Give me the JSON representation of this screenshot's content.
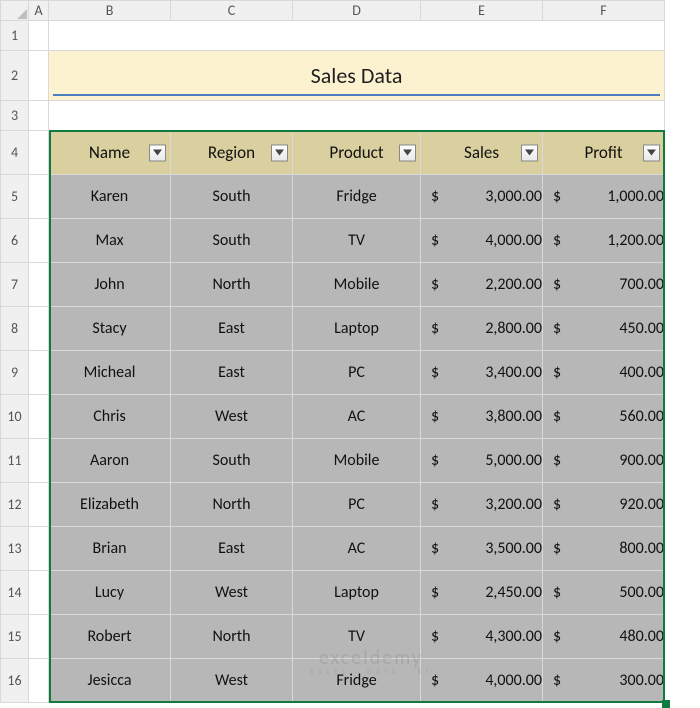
{
  "columns": [
    "A",
    "B",
    "C",
    "D",
    "E",
    "F"
  ],
  "row_numbers": [
    1,
    2,
    3,
    4,
    5,
    6,
    7,
    8,
    9,
    10,
    11,
    12,
    13,
    14,
    15,
    16
  ],
  "title": "Sales Data",
  "headers": {
    "name": "Name",
    "region": "Region",
    "product": "Product",
    "sales": "Sales",
    "profit": "Profit"
  },
  "rows": [
    {
      "name": "Karen",
      "region": "South",
      "product": "Fridge",
      "sales": "3,000.00",
      "profit": "1,000.00"
    },
    {
      "name": "Max",
      "region": "South",
      "product": "TV",
      "sales": "4,000.00",
      "profit": "1,200.00"
    },
    {
      "name": "John",
      "region": "North",
      "product": "Mobile",
      "sales": "2,200.00",
      "profit": "700.00"
    },
    {
      "name": "Stacy",
      "region": "East",
      "product": "Laptop",
      "sales": "2,800.00",
      "profit": "450.00"
    },
    {
      "name": "Micheal",
      "region": "East",
      "product": "PC",
      "sales": "3,400.00",
      "profit": "400.00"
    },
    {
      "name": "Chris",
      "region": "West",
      "product": "AC",
      "sales": "3,800.00",
      "profit": "560.00"
    },
    {
      "name": "Aaron",
      "region": "South",
      "product": "Mobile",
      "sales": "5,000.00",
      "profit": "900.00"
    },
    {
      "name": "Elizabeth",
      "region": "North",
      "product": "PC",
      "sales": "3,200.00",
      "profit": "920.00"
    },
    {
      "name": "Brian",
      "region": "East",
      "product": "AC",
      "sales": "3,500.00",
      "profit": "800.00"
    },
    {
      "name": "Lucy",
      "region": "West",
      "product": "Laptop",
      "sales": "2,450.00",
      "profit": "500.00"
    },
    {
      "name": "Robert",
      "region": "North",
      "product": "TV",
      "sales": "4,300.00",
      "profit": "480.00"
    },
    {
      "name": "Jesicca",
      "region": "West",
      "product": "Fridge",
      "sales": "4,000.00",
      "profit": "300.00"
    }
  ],
  "currency": "$",
  "watermark": {
    "main": "exceldemy",
    "sub": "EXCEL · DATA · BI"
  },
  "chart_data": {
    "type": "table",
    "title": "Sales Data",
    "columns": [
      "Name",
      "Region",
      "Product",
      "Sales",
      "Profit"
    ],
    "data": [
      [
        "Karen",
        "South",
        "Fridge",
        3000.0,
        1000.0
      ],
      [
        "Max",
        "South",
        "TV",
        4000.0,
        1200.0
      ],
      [
        "John",
        "North",
        "Mobile",
        2200.0,
        700.0
      ],
      [
        "Stacy",
        "East",
        "Laptop",
        2800.0,
        450.0
      ],
      [
        "Micheal",
        "East",
        "PC",
        3400.0,
        400.0
      ],
      [
        "Chris",
        "West",
        "AC",
        3800.0,
        560.0
      ],
      [
        "Aaron",
        "South",
        "Mobile",
        5000.0,
        900.0
      ],
      [
        "Elizabeth",
        "North",
        "PC",
        3200.0,
        920.0
      ],
      [
        "Brian",
        "East",
        "AC",
        3500.0,
        800.0
      ],
      [
        "Lucy",
        "West",
        "Laptop",
        2450.0,
        500.0
      ],
      [
        "Robert",
        "North",
        "TV",
        4300.0,
        480.0
      ],
      [
        "Jesicca",
        "West",
        "Fridge",
        4000.0,
        300.0
      ]
    ]
  }
}
